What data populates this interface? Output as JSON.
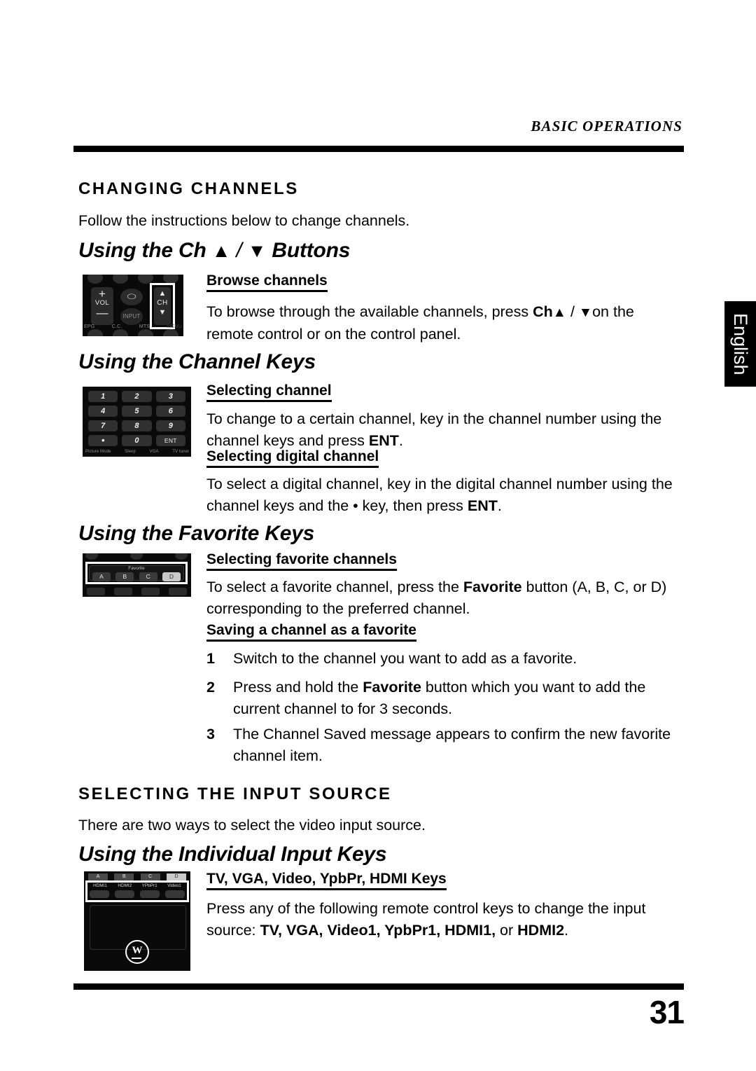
{
  "running_head": "BASIC OPERATIONS",
  "language_tab": "English",
  "page_number": "31",
  "sections": [
    {
      "heading": "CHANGING CHANNELS",
      "intro": "Follow the instructions below to change channels.",
      "sub_heading": "Using the Ch ▲ / ▼ Buttons",
      "sub_heading_parts": {
        "prefix": "Using the Ch",
        "up": "▲",
        "slash": "/",
        "down": "▼",
        "suffix": "Buttons"
      },
      "minor_heading": "Browse channels",
      "body_line_1": "To browse through the available channels, press",
      "body_ch": "Ch",
      "body_up": "▲",
      "body_slash": "/",
      "body_down": "▼",
      "body_on": "on",
      "body_line_2": "the remote control or on the control panel."
    }
  ],
  "channel_keys": {
    "sub_heading": "Using the Channel Keys",
    "minor_heading_1": "Selecting channel",
    "body_1a": "To change to a certain channel, key in the channel number using",
    "body_1b_pre": "the channel keys and press",
    "body_1b_bold": "ENT",
    "body_1b_post": ".",
    "minor_heading_2": "Selecting digital channel",
    "body_2a": "To select a digital channel, key in the digital channel number using",
    "body_2b_pre": "the channel keys and the • key, then press",
    "body_2b_bold": "ENT",
    "body_2b_post": "."
  },
  "favorite_keys": {
    "sub_heading": "Using the Favorite Keys",
    "minor_heading_1": "Selecting favorite channels",
    "body_1a_pre": "To select a favorite channel, press the",
    "body_1a_bold": "Favorite",
    "body_1a_post": "button (A, B, C, or",
    "body_1b": "D) corresponding to the preferred channel.",
    "minor_heading_2": "Saving a channel as a favorite",
    "steps": [
      {
        "num": "1",
        "text": "Switch to the channel you want to add as a favorite."
      },
      {
        "num": "2",
        "pre": "Press and hold the",
        "bold": "Favorite",
        "post": "button which you want to add",
        "line2": "the current channel to for 3 seconds."
      },
      {
        "num": "3",
        "text": "The Channel Saved message appears to confirm the new",
        "line2": "favorite channel item."
      }
    ]
  },
  "input_source": {
    "heading": "SELECTING THE INPUT SOURCE",
    "intro": "There are two ways to select the video input source.",
    "sub_heading": "Using the Individual Input Keys",
    "minor_heading": "TV, VGA, Video, YpbPr, HDMI Keys",
    "body_a": "Press any of the following remote control keys to change the input",
    "body_b_pre": "source:",
    "body_b_keys": "TV, VGA, Video1, YpbPr1, HDMI1,",
    "body_b_mid": "or",
    "body_b_last": "HDMI2",
    "body_b_post": "."
  },
  "artwork": {
    "control_panel": {
      "vol_plus": "+",
      "vol_label": "VOL",
      "vol_minus": "—",
      "aspect_icon": "⬭",
      "input_label": "INPUT",
      "ch_up": "▲",
      "ch_label": "CH",
      "ch_down": "▼",
      "captions": [
        "EPG",
        "C.C.",
        "MTS",
        "MENU"
      ]
    },
    "keypad": {
      "keys": [
        "1",
        "2",
        "3",
        "4",
        "5",
        "6",
        "7",
        "8",
        "9",
        "•",
        "0",
        "ENT"
      ],
      "captions": [
        "Picture Mode",
        "Sleep",
        "VGA",
        "TV tuner"
      ]
    },
    "favorite_panel": {
      "title": "Favorite",
      "keys": [
        "A",
        "B",
        "C",
        "D"
      ],
      "highlighted": "D"
    },
    "input_panel": {
      "abcd": [
        "A",
        "B",
        "C",
        "D"
      ],
      "labels": [
        "HDMI1",
        "HDMI2",
        "YPbPr1",
        "Video1"
      ],
      "highlighted": "D",
      "brand_mark": "W"
    }
  }
}
